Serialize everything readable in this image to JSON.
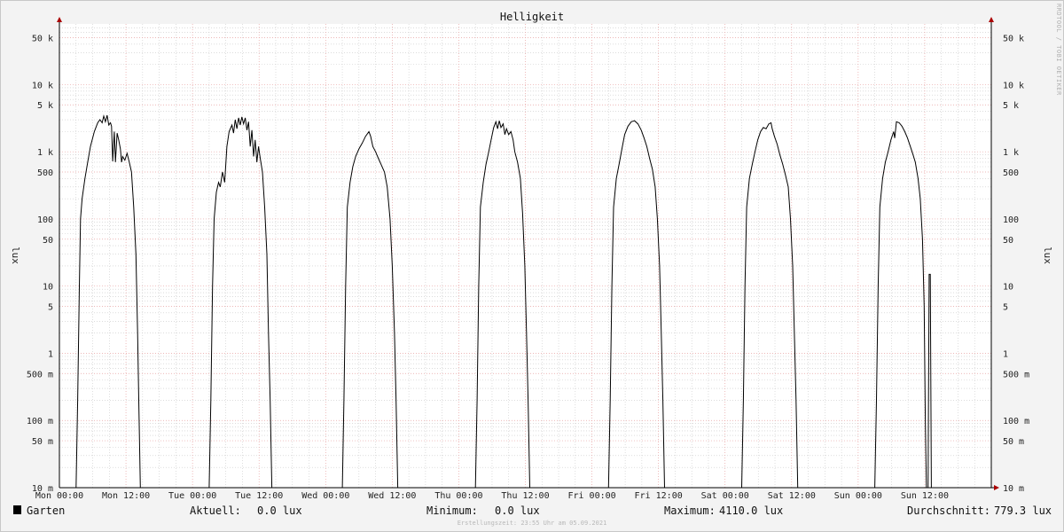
{
  "colors": {
    "background": "#f3f3f3",
    "plot_background": "#ffffff",
    "major_grid": "#e8a0a0",
    "minor_grid": "#c8c8c8",
    "axis": "#000000",
    "arrow": "#aa0000",
    "series": "#000000"
  },
  "watermark": "RRDTOOL / TOBI OETIKER",
  "footer": {
    "timestamp": "Erstellungszeit: 23:55 Uhr am 05.09.2021"
  },
  "legend": {
    "series_name": "Garten",
    "stats": [
      {
        "label": "Aktuell:",
        "value": "0.0 lux"
      },
      {
        "label": "Minimum:",
        "value": "0.0 lux"
      },
      {
        "label": "Maximum:",
        "value": "4110.0 lux"
      },
      {
        "label": "Durchschnitt:",
        "value": "779.3 lux"
      }
    ]
  },
  "chart_data": {
    "type": "line",
    "title": "Helligkeit",
    "ylabel": "lux",
    "ylabel_right": "lux",
    "yscale": "log",
    "ylim": [
      0.01,
      80000
    ],
    "y_ticks": [
      {
        "value": 0.01,
        "label": "10 m"
      },
      {
        "value": 0.05,
        "label": "50 m"
      },
      {
        "value": 0.1,
        "label": "100 m"
      },
      {
        "value": 0.5,
        "label": "500 m"
      },
      {
        "value": 1,
        "label": "1"
      },
      {
        "value": 5,
        "label": "5"
      },
      {
        "value": 10,
        "label": "10"
      },
      {
        "value": 50,
        "label": "50"
      },
      {
        "value": 100,
        "label": "100"
      },
      {
        "value": 500,
        "label": "500"
      },
      {
        "value": 1000,
        "label": "1 k"
      },
      {
        "value": 5000,
        "label": "5 k"
      },
      {
        "value": 10000,
        "label": "10 k"
      },
      {
        "value": 50000,
        "label": "50 k"
      }
    ],
    "xlim": [
      0,
      168
    ],
    "x_unit": "hours since Mon 00:00",
    "x_ticks": [
      {
        "value": 0,
        "label": "Mon 00:00"
      },
      {
        "value": 12,
        "label": "Mon 12:00"
      },
      {
        "value": 24,
        "label": "Tue 00:00"
      },
      {
        "value": 36,
        "label": "Tue 12:00"
      },
      {
        "value": 48,
        "label": "Wed 00:00"
      },
      {
        "value": 60,
        "label": "Wed 12:00"
      },
      {
        "value": 72,
        "label": "Thu 00:00"
      },
      {
        "value": 84,
        "label": "Thu 12:00"
      },
      {
        "value": 96,
        "label": "Fri 00:00"
      },
      {
        "value": 108,
        "label": "Fri 12:00"
      },
      {
        "value": 120,
        "label": "Sat 00:00"
      },
      {
        "value": 132,
        "label": "Sat 12:00"
      },
      {
        "value": 144,
        "label": "Sun 00:00"
      },
      {
        "value": 156,
        "label": "Sun 12:00"
      }
    ],
    "grid": true,
    "series": [
      {
        "name": "Garten",
        "color": "#000000",
        "points": [
          [
            0,
            0.01
          ],
          [
            3.0,
            0.01
          ],
          [
            3.3,
            0.2
          ],
          [
            3.6,
            10
          ],
          [
            3.8,
            100
          ],
          [
            4.1,
            200
          ],
          [
            4.6,
            400
          ],
          [
            5.1,
            700
          ],
          [
            5.6,
            1200
          ],
          [
            6.3,
            2000
          ],
          [
            6.9,
            2700
          ],
          [
            7.3,
            3000
          ],
          [
            7.7,
            2700
          ],
          [
            8.0,
            3400
          ],
          [
            8.3,
            2800
          ],
          [
            8.6,
            3500
          ],
          [
            8.9,
            2500
          ],
          [
            9.2,
            2700
          ],
          [
            9.4,
            2400
          ],
          [
            9.6,
            720
          ],
          [
            9.9,
            2000
          ],
          [
            10.1,
            700
          ],
          [
            10.4,
            1900
          ],
          [
            10.7,
            1500
          ],
          [
            11.0,
            1100
          ],
          [
            11.2,
            700
          ],
          [
            11.4,
            850
          ],
          [
            11.8,
            750
          ],
          [
            12.2,
            950
          ],
          [
            12.6,
            700
          ],
          [
            13.0,
            500
          ],
          [
            13.4,
            150
          ],
          [
            13.8,
            30
          ],
          [
            14.1,
            2
          ],
          [
            14.3,
            0.2
          ],
          [
            14.6,
            0.01
          ],
          [
            27.0,
            0.01
          ],
          [
            27.3,
            0.2
          ],
          [
            27.6,
            10
          ],
          [
            27.9,
            100
          ],
          [
            28.3,
            250
          ],
          [
            28.7,
            350
          ],
          [
            29.0,
            300
          ],
          [
            29.4,
            500
          ],
          [
            29.8,
            350
          ],
          [
            30.2,
            1200
          ],
          [
            30.6,
            2000
          ],
          [
            31.1,
            2500
          ],
          [
            31.4,
            1900
          ],
          [
            31.7,
            3000
          ],
          [
            32.0,
            2200
          ],
          [
            32.3,
            3200
          ],
          [
            32.6,
            2500
          ],
          [
            32.9,
            3300
          ],
          [
            33.2,
            2600
          ],
          [
            33.5,
            3200
          ],
          [
            33.8,
            2100
          ],
          [
            34.1,
            2800
          ],
          [
            34.4,
            1200
          ],
          [
            34.7,
            2100
          ],
          [
            35.0,
            850
          ],
          [
            35.3,
            1500
          ],
          [
            35.6,
            700
          ],
          [
            35.9,
            1200
          ],
          [
            36.2,
            800
          ],
          [
            36.6,
            500
          ],
          [
            37.0,
            150
          ],
          [
            37.4,
            30
          ],
          [
            37.7,
            2
          ],
          [
            38.0,
            0.2
          ],
          [
            38.3,
            0.01
          ],
          [
            51.0,
            0.01
          ],
          [
            51.3,
            0.2
          ],
          [
            51.6,
            10
          ],
          [
            51.9,
            150
          ],
          [
            52.4,
            350
          ],
          [
            52.9,
            600
          ],
          [
            53.4,
            850
          ],
          [
            54.0,
            1100
          ],
          [
            54.6,
            1350
          ],
          [
            55.2,
            1700
          ],
          [
            55.8,
            2000
          ],
          [
            56.1,
            1700
          ],
          [
            56.5,
            1200
          ],
          [
            57.0,
            1000
          ],
          [
            57.5,
            800
          ],
          [
            58.0,
            650
          ],
          [
            58.6,
            500
          ],
          [
            59.1,
            300
          ],
          [
            59.6,
            100
          ],
          [
            60.0,
            20
          ],
          [
            60.4,
            2
          ],
          [
            60.7,
            0.2
          ],
          [
            61.0,
            0.01
          ],
          [
            75.0,
            0.01
          ],
          [
            75.3,
            0.2
          ],
          [
            75.6,
            10
          ],
          [
            75.9,
            150
          ],
          [
            76.4,
            350
          ],
          [
            76.9,
            650
          ],
          [
            77.4,
            1000
          ],
          [
            77.9,
            1600
          ],
          [
            78.3,
            2300
          ],
          [
            78.7,
            2800
          ],
          [
            79.0,
            2200
          ],
          [
            79.3,
            2900
          ],
          [
            79.6,
            2300
          ],
          [
            80.0,
            2600
          ],
          [
            80.3,
            1800
          ],
          [
            80.6,
            2200
          ],
          [
            81.0,
            1800
          ],
          [
            81.4,
            2000
          ],
          [
            81.8,
            1500
          ],
          [
            82.1,
            1000
          ],
          [
            82.6,
            700
          ],
          [
            83.1,
            400
          ],
          [
            83.5,
            120
          ],
          [
            83.9,
            20
          ],
          [
            84.2,
            2
          ],
          [
            84.5,
            0.2
          ],
          [
            84.8,
            0.01
          ],
          [
            99.0,
            0.01
          ],
          [
            99.3,
            0.2
          ],
          [
            99.6,
            10
          ],
          [
            99.9,
            150
          ],
          [
            100.4,
            400
          ],
          [
            100.9,
            650
          ],
          [
            101.4,
            1100
          ],
          [
            101.9,
            1800
          ],
          [
            102.5,
            2400
          ],
          [
            103.1,
            2800
          ],
          [
            103.7,
            2900
          ],
          [
            104.3,
            2600
          ],
          [
            104.9,
            2100
          ],
          [
            105.4,
            1600
          ],
          [
            105.9,
            1200
          ],
          [
            106.4,
            800
          ],
          [
            106.9,
            550
          ],
          [
            107.4,
            300
          ],
          [
            107.8,
            100
          ],
          [
            108.2,
            20
          ],
          [
            108.5,
            2
          ],
          [
            108.8,
            0.2
          ],
          [
            109.1,
            0.01
          ],
          [
            123.0,
            0.01
          ],
          [
            123.3,
            0.2
          ],
          [
            123.6,
            10
          ],
          [
            123.9,
            150
          ],
          [
            124.4,
            400
          ],
          [
            124.9,
            650
          ],
          [
            125.4,
            1000
          ],
          [
            125.9,
            1500
          ],
          [
            126.4,
            2000
          ],
          [
            126.9,
            2300
          ],
          [
            127.4,
            2200
          ],
          [
            127.9,
            2600
          ],
          [
            128.3,
            2700
          ],
          [
            128.5,
            2200
          ],
          [
            128.9,
            1700
          ],
          [
            129.4,
            1300
          ],
          [
            129.9,
            900
          ],
          [
            130.4,
            650
          ],
          [
            130.9,
            450
          ],
          [
            131.4,
            300
          ],
          [
            131.8,
            100
          ],
          [
            132.2,
            20
          ],
          [
            132.5,
            2
          ],
          [
            132.8,
            0.2
          ],
          [
            133.1,
            0.01
          ],
          [
            147.0,
            0.01
          ],
          [
            147.3,
            0.2
          ],
          [
            147.6,
            10
          ],
          [
            147.9,
            150
          ],
          [
            148.4,
            400
          ],
          [
            148.9,
            700
          ],
          [
            149.4,
            1000
          ],
          [
            149.9,
            1500
          ],
          [
            150.4,
            2000
          ],
          [
            150.6,
            1600
          ],
          [
            150.9,
            2800
          ],
          [
            151.4,
            2700
          ],
          [
            151.9,
            2400
          ],
          [
            152.4,
            2000
          ],
          [
            152.9,
            1600
          ],
          [
            153.4,
            1200
          ],
          [
            153.9,
            900
          ],
          [
            154.3,
            700
          ],
          [
            154.8,
            400
          ],
          [
            155.2,
            200
          ],
          [
            155.6,
            50
          ],
          [
            155.9,
            5
          ],
          [
            156.1,
            0.1
          ],
          [
            156.3,
            0.01
          ],
          [
            156.6,
            0.01
          ],
          [
            156.8,
            15
          ],
          [
            157.0,
            15
          ],
          [
            157.2,
            0.01
          ],
          [
            157.4,
            0.01
          ]
        ]
      }
    ]
  }
}
